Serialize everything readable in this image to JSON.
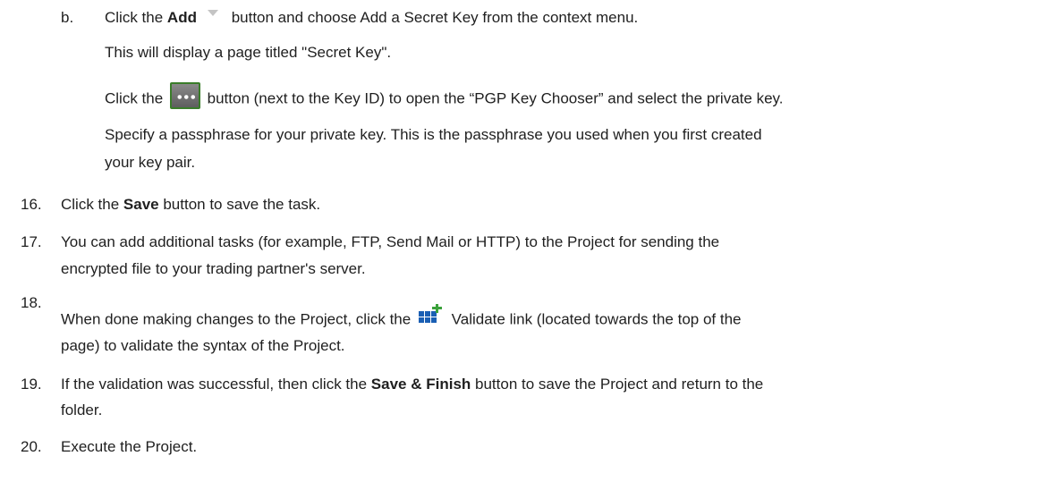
{
  "step_b": {
    "marker": "b.",
    "pre": "Click the ",
    "bold": "Add",
    "post": " button and choose Add a Secret Key from the context menu."
  },
  "step_b_result": "This will display a page titled \"Secret Key\".",
  "keyid": {
    "pre": "Click the ",
    "post": " button (next to the Key ID) to open the “PGP Key Chooser” and select the private key."
  },
  "passphrase": {
    "line1": "Specify a passphrase for your private key.  This is the passphrase you used when you first created",
    "line2": "your key pair."
  },
  "step16": {
    "num": "16.",
    "pre": "Click the ",
    "bold": "Save",
    "post": " button to save the task."
  },
  "step17": {
    "num": "17.",
    "line1": "You can add additional tasks (for example, FTP, Send Mail or HTTP) to the Project for sending the",
    "line2": "encrypted file to your trading partner's server."
  },
  "step18": {
    "num": "18.",
    "pre": "When done making changes to the Project, click the ",
    "post": " Validate link (located towards the top of the",
    "line2": "page) to validate the syntax of the Project."
  },
  "step19": {
    "num": "19.",
    "pre": "If the validation was successful, then click the ",
    "bold": "Save & Finish",
    "post": " button to save the Project and return to the",
    "line2": "folder."
  },
  "step20": {
    "num": "20.",
    "text": "Execute the Project."
  },
  "icons": {
    "dropdown": "chevron-down-icon",
    "ellipsis": "ellipsis-button-icon",
    "validate": "validate-icon"
  },
  "colors": {
    "text": "#1f1f1f",
    "validate_blue": "#1a5fb4",
    "validate_green": "#3aa13a"
  }
}
